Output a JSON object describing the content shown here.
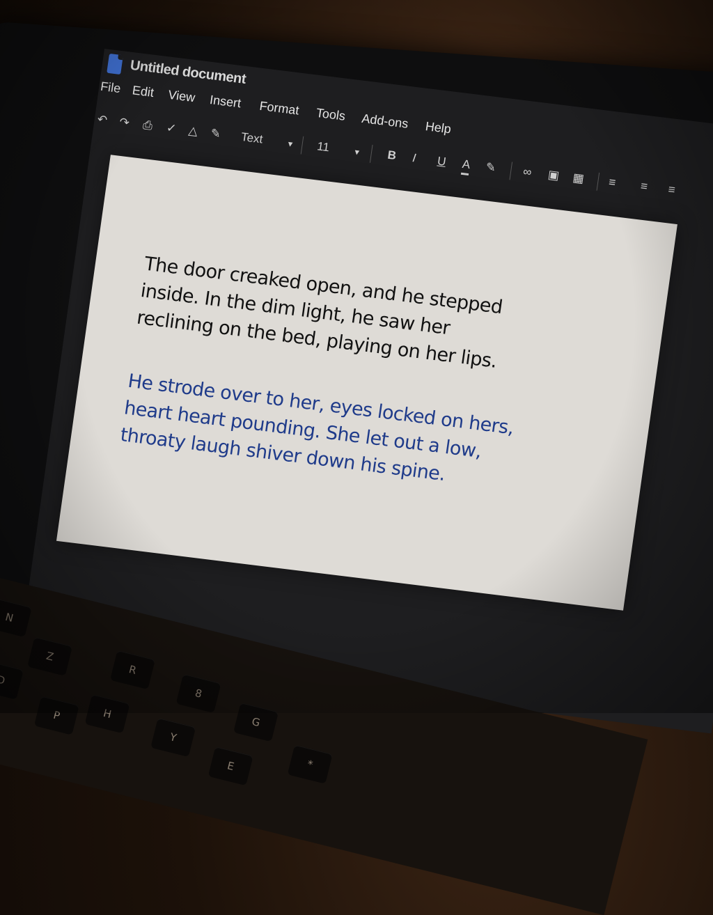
{
  "app": {
    "title": "Untitled document"
  },
  "menu": {
    "items": [
      "File",
      "Edit",
      "View",
      "Insert",
      "Format",
      "Tools",
      "Add-ons",
      "Help"
    ]
  },
  "toolbar": {
    "style_select": "Text",
    "font_size": "11",
    "bold": "B",
    "italic": "I",
    "underline": "U",
    "text_color": "A",
    "icons": [
      "undo-icon",
      "redo-icon",
      "print-icon",
      "spellcheck-icon",
      "paint-format-icon",
      "highlight-icon",
      "pen-icon",
      "link-icon",
      "comment-icon",
      "image-icon",
      "align-icon",
      "line-spacing-icon",
      "list-icon"
    ]
  },
  "document": {
    "paragraphs": [
      "The door creaked open, and he stepped inside. In the dim light, he saw her reclining on the bed, playing on her lips.",
      "He strode over to her, eyes locked on hers, heart heart pounding. She let out a low, throaty laugh shiver down his spine."
    ]
  },
  "keyboard": {
    "keys": [
      "N",
      "Z",
      "D",
      "R",
      "8",
      "Y",
      "P",
      "G",
      "H",
      "E",
      "*"
    ]
  },
  "colors": {
    "paragraph_1": "#111111",
    "paragraph_2": "#1f3b8a",
    "doc_icon": "#3f6fd0"
  }
}
